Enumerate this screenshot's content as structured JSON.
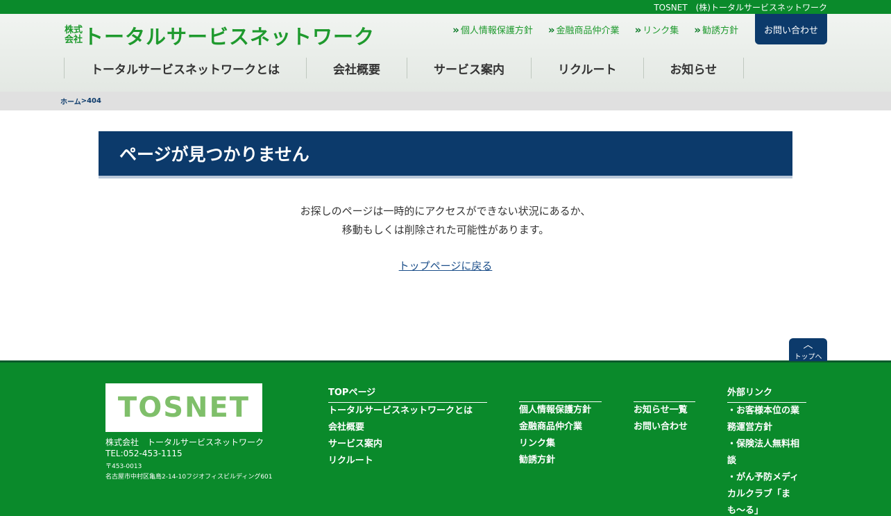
{
  "topbar": {
    "text": "TOSNET　(株)トータルサービスネットワーク"
  },
  "header": {
    "logo_small": "株式会社",
    "logo_main": "トータルサービスネットワーク",
    "util_links": [
      "個人情報保護方針",
      "金融商品仲介業",
      "リンク集",
      "勧誘方針"
    ],
    "contact": "お問い合わせ",
    "nav": [
      "トータルサービスネットワークとは",
      "会社概要",
      "サービス案内",
      "リクルート",
      "お知らせ"
    ]
  },
  "breadcrumb": {
    "home": "ホーム",
    "sep": " > ",
    "current": "404"
  },
  "content": {
    "heading": "ページが見つかりません",
    "line1": "お探しのページは一時的にアクセスができない状況にあるか、",
    "line2": "移動もしくは削除された可能性があります。",
    "back": "トップページに戻る"
  },
  "totop": "トップへ",
  "footer": {
    "logo": "TOSNET",
    "company": "株式会社　トータルサービスネットワーク",
    "tel": "TEL:052-453-1115",
    "zip": "〒453-0013",
    "address": "名古屋市中村区亀島2-14-10フジオフィスビルディング601",
    "col1": {
      "head": "TOPページ",
      "items": [
        "トータルサービスネットワークとは",
        "会社概要",
        "サービス案内",
        "リクルート"
      ]
    },
    "col2": {
      "items": [
        "個人情報保護方針",
        "金融商品仲介業",
        "リンク集",
        "勧誘方針"
      ]
    },
    "col3": {
      "items": [
        "お知らせ一覧",
        "お問い合わせ"
      ]
    },
    "col4": {
      "head": "外部リンク",
      "items": [
        "・お客様本位の業務運営方針",
        "・保険法人無料相談",
        "・がん予防メディカルクラブ「まも〜る」"
      ]
    }
  }
}
